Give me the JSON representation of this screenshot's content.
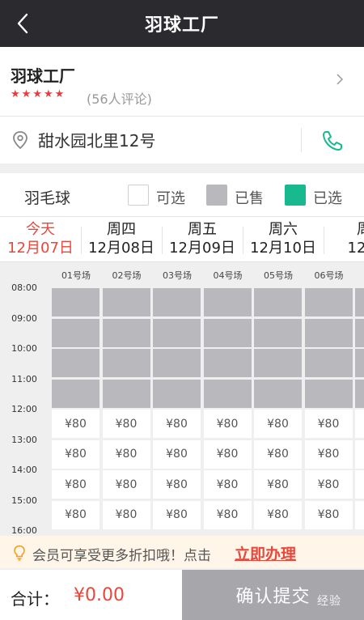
{
  "header": {
    "title": "羽球工厂"
  },
  "shop": {
    "name": "羽球工厂",
    "rating_stars": 5,
    "reviews": "(56人评论)"
  },
  "address": {
    "text": "甜水园北里12号"
  },
  "legend": {
    "sport": "羽毛球",
    "available": "可选",
    "sold": "已售",
    "selected": "已选",
    "colors": {
      "available": "#ffffff",
      "sold": "#b9b8bd",
      "selected": "#19b990"
    }
  },
  "dates": [
    {
      "week": "今天",
      "date": "12月07日",
      "active": true
    },
    {
      "week": "周四",
      "date": "12月08日",
      "active": false
    },
    {
      "week": "周五",
      "date": "12月09日",
      "active": false
    },
    {
      "week": "周六",
      "date": "12月10日",
      "active": false
    },
    {
      "week": "周",
      "date": "12月",
      "active": false
    }
  ],
  "courts": [
    "01号场",
    "02号场",
    "03号场",
    "04号场",
    "05号场",
    "06号场"
  ],
  "times": [
    "08:00",
    "09:00",
    "10:00",
    "11:00",
    "12:00",
    "13:00",
    "14:00",
    "15:00",
    "16:00"
  ],
  "slots": [
    {
      "status": "sold",
      "price": ""
    },
    {
      "status": "sold",
      "price": ""
    },
    {
      "status": "sold",
      "price": ""
    },
    {
      "status": "sold",
      "price": ""
    },
    {
      "status": "available",
      "price": "¥80"
    },
    {
      "status": "available",
      "price": "¥80"
    },
    {
      "status": "available",
      "price": "¥80"
    },
    {
      "status": "available",
      "price": "¥80"
    }
  ],
  "promo": {
    "text": "会员可享受更多折扣哦！点击",
    "link": "立即办理"
  },
  "footer": {
    "total_label": "合计：",
    "total_value": "¥0.00",
    "submit": "确认提交",
    "watermark": "经验"
  }
}
